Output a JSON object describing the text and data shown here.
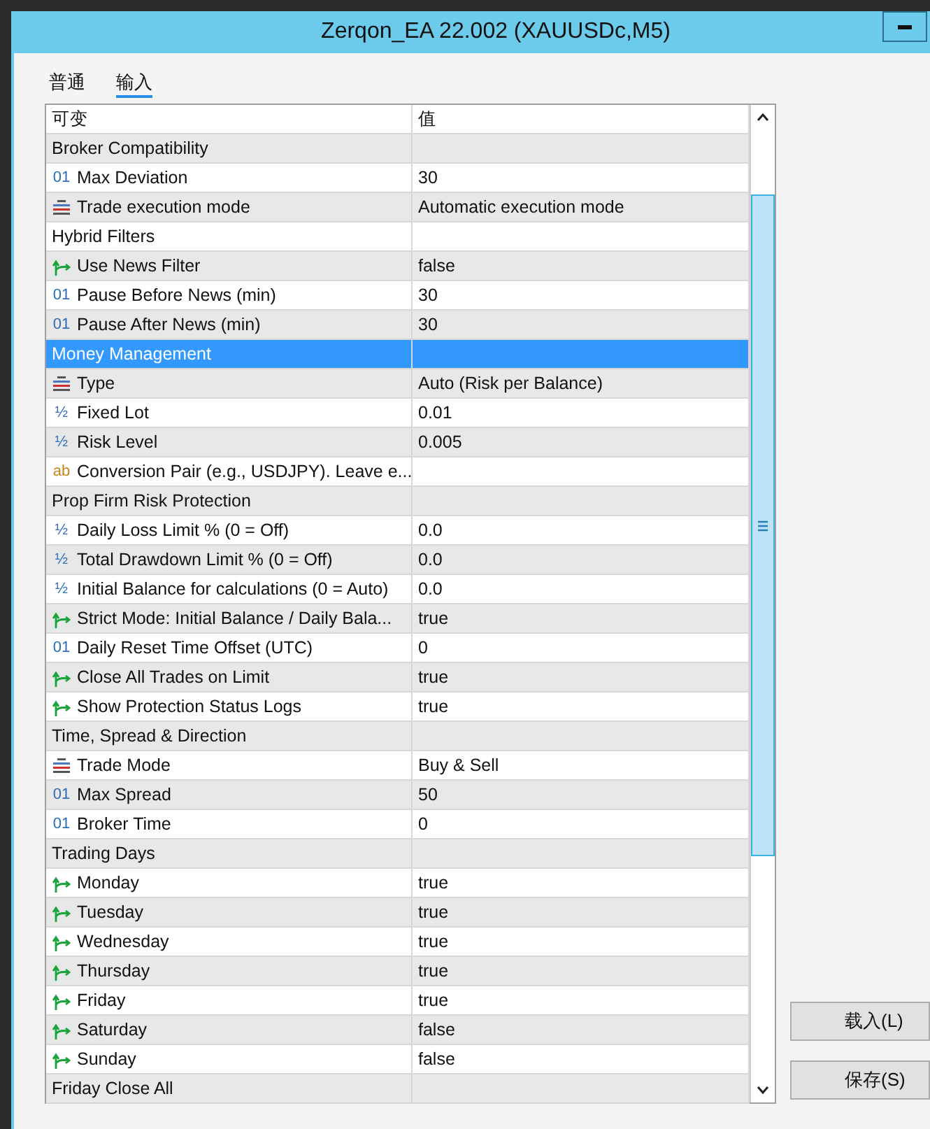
{
  "window": {
    "title": "Zerqon_EA 22.002 (XAUUSDc,M5)"
  },
  "tabs": [
    {
      "label": "普通",
      "selected": false
    },
    {
      "label": "输入",
      "selected": true
    }
  ],
  "table": {
    "columns": [
      "可变",
      "值"
    ],
    "rows": [
      {
        "kind": "group",
        "name": "Broker Compatibility",
        "selected": false
      },
      {
        "kind": "int",
        "icon": "01",
        "name": "Max Deviation",
        "value": "30",
        "selected": false
      },
      {
        "kind": "enum",
        "name": "Trade execution mode",
        "value": "Automatic execution mode",
        "selected": false
      },
      {
        "kind": "group",
        "name": "Hybrid Filters",
        "selected": false
      },
      {
        "kind": "bool",
        "name": "Use News Filter",
        "value": "false",
        "selected": false
      },
      {
        "kind": "int",
        "icon": "01",
        "name": "Pause Before News (min)",
        "value": "30",
        "selected": false
      },
      {
        "kind": "int",
        "icon": "01",
        "name": "Pause After News (min)",
        "value": "30",
        "selected": false
      },
      {
        "kind": "group",
        "name": "Money Management",
        "selected": true
      },
      {
        "kind": "enum",
        "name": "Type",
        "value": "Auto (Risk per Balance)",
        "selected": false
      },
      {
        "kind": "double",
        "icon": "½",
        "name": "Fixed Lot",
        "value": "0.01",
        "selected": false
      },
      {
        "kind": "double",
        "icon": "½",
        "name": "Risk Level",
        "value": "0.005",
        "selected": false
      },
      {
        "kind": "string",
        "icon": "ab",
        "name": "Conversion Pair (e.g., USDJPY). Leave e...",
        "selected": false
      },
      {
        "kind": "group",
        "name": "Prop Firm Risk Protection",
        "selected": false
      },
      {
        "kind": "double",
        "icon": "½",
        "name": "Daily Loss Limit % (0 = Off)",
        "value": "0.0",
        "selected": false
      },
      {
        "kind": "double",
        "icon": "½",
        "name": "Total Drawdown Limit % (0 = Off)",
        "value": "0.0",
        "selected": false
      },
      {
        "kind": "double",
        "icon": "½",
        "name": "Initial Balance for calculations (0 = Auto)",
        "value": "0.0",
        "selected": false
      },
      {
        "kind": "bool",
        "name": "Strict Mode: Initial Balance / Daily Bala...",
        "value": "true",
        "selected": false
      },
      {
        "kind": "int",
        "icon": "01",
        "name": "Daily Reset Time Offset (UTC)",
        "value": "0",
        "selected": false
      },
      {
        "kind": "bool",
        "name": "Close All Trades on Limit",
        "value": "true",
        "selected": false
      },
      {
        "kind": "bool",
        "name": "Show Protection Status Logs",
        "value": "true",
        "selected": false
      },
      {
        "kind": "group",
        "name": "Time, Spread & Direction",
        "selected": false
      },
      {
        "kind": "enum",
        "name": "Trade Mode",
        "value": "Buy & Sell",
        "selected": false
      },
      {
        "kind": "int",
        "icon": "01",
        "name": "Max Spread",
        "value": "50",
        "selected": false
      },
      {
        "kind": "int",
        "icon": "01",
        "name": "Broker Time",
        "value": "0",
        "selected": false
      },
      {
        "kind": "group",
        "name": "Trading Days",
        "selected": false
      },
      {
        "kind": "bool",
        "name": "Monday",
        "value": "true",
        "selected": false
      },
      {
        "kind": "bool",
        "name": "Tuesday",
        "value": "true",
        "selected": false
      },
      {
        "kind": "bool",
        "name": "Wednesday",
        "value": "true",
        "selected": false
      },
      {
        "kind": "bool",
        "name": "Thursday",
        "value": "true",
        "selected": false
      },
      {
        "kind": "bool",
        "name": "Friday",
        "value": "true",
        "selected": false
      },
      {
        "kind": "bool",
        "name": "Saturday",
        "value": "false",
        "selected": false
      },
      {
        "kind": "bool",
        "name": "Sunday",
        "value": "false",
        "selected": false
      },
      {
        "kind": "group",
        "name": "Friday Close All",
        "selected": false
      }
    ]
  },
  "buttons": [
    {
      "label": "载入(L)"
    },
    {
      "label": "保存(S)"
    }
  ]
}
